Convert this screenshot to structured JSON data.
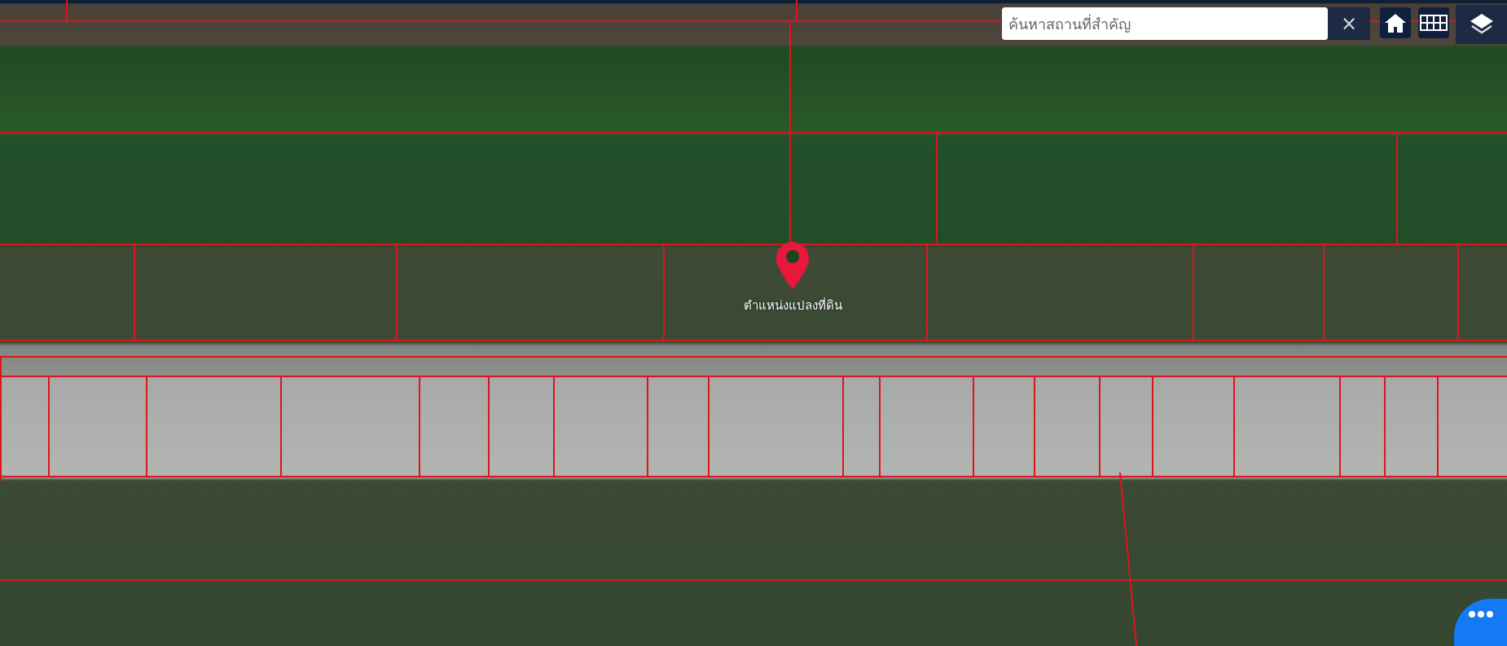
{
  "search": {
    "placeholder": "ค้นหาสถานที่สำคัญ",
    "clear": "×"
  },
  "map": {
    "marker": {
      "label": "ตำแหน่งแปลงที่ดิน"
    }
  }
}
